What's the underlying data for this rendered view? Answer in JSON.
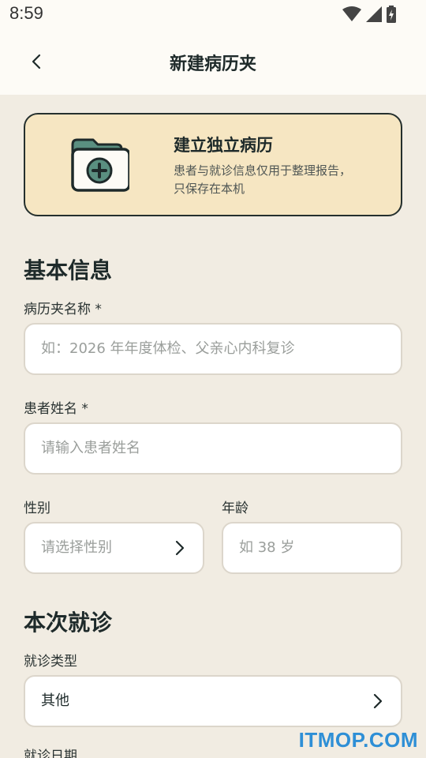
{
  "status": {
    "time": "8:59"
  },
  "header": {
    "title": "新建病历夹"
  },
  "banner": {
    "title": "建立独立病历",
    "desc_line1": "患者与就诊信息仅用于整理报告，",
    "desc_line2": "只保存在本机"
  },
  "basic": {
    "title": "基本信息",
    "folder_label": "病历夹名称 *",
    "folder_placeholder": "如：2026 年年度体检、父亲心内科复诊",
    "patient_label": "患者姓名 *",
    "patient_placeholder": "请输入患者姓名",
    "gender_label": "性别",
    "gender_placeholder": "请选择性别",
    "age_label": "年龄",
    "age_placeholder": "如 38 岁"
  },
  "visit": {
    "title": "本次就诊",
    "type_label": "就诊类型",
    "type_value": "其他",
    "date_label": "就诊日期"
  },
  "watermark": "ITMOP.COM",
  "colors": {
    "accent": "#f6e6c2",
    "background": "#f1ece2",
    "text": "#1e2a2a"
  },
  "icons": [
    "back-arrow-icon",
    "folder-plus-icon",
    "chevron-right-icon",
    "wifi-icon",
    "signal-icon",
    "battery-icon"
  ]
}
